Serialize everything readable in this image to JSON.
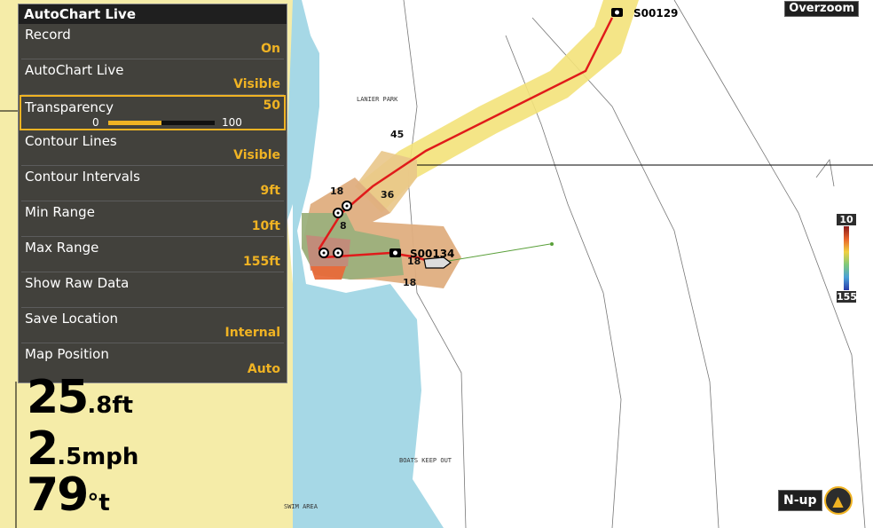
{
  "menu": {
    "title": "AutoChart Live",
    "items": [
      {
        "label": "Record",
        "value": "On"
      },
      {
        "label": "AutoChart Live",
        "value": "Visible"
      },
      {
        "label": "Transparency",
        "value": "50",
        "min": "0",
        "max": "100",
        "level": 0.5
      },
      {
        "label": "Contour Lines",
        "value": "Visible"
      },
      {
        "label": "Contour Intervals",
        "value": "9ft"
      },
      {
        "label": "Min Range",
        "value": "10ft"
      },
      {
        "label": "Max Range",
        "value": "155ft"
      },
      {
        "label": "Show Raw Data",
        "value": ""
      },
      {
        "label": "Save Location",
        "value": "Internal"
      },
      {
        "label": "Map Position",
        "value": "Auto"
      }
    ]
  },
  "overzoom": "Overzoom",
  "scale": {
    "top": "10",
    "bottom": "155"
  },
  "waypoints": {
    "top": "S00129",
    "mid": "S00134"
  },
  "depths": [
    "45",
    "36",
    "18",
    "8",
    "18",
    "18"
  ],
  "map_labels": {
    "park": "LANIER PARK",
    "boats": "BOATS KEEP OUT",
    "swim": "SWIM AREA"
  },
  "digital": {
    "depth": {
      "value": "25",
      "unit": ".8ft"
    },
    "speed": {
      "value": "2",
      "unit": ".5mph"
    },
    "temp": {
      "value": "79",
      "unit": "°t"
    }
  },
  "orientation": "N-up",
  "colors": {
    "accent": "#f0b323",
    "water": "#a6d8e6",
    "land": "#f5eca8",
    "track": "#e01b1b"
  }
}
